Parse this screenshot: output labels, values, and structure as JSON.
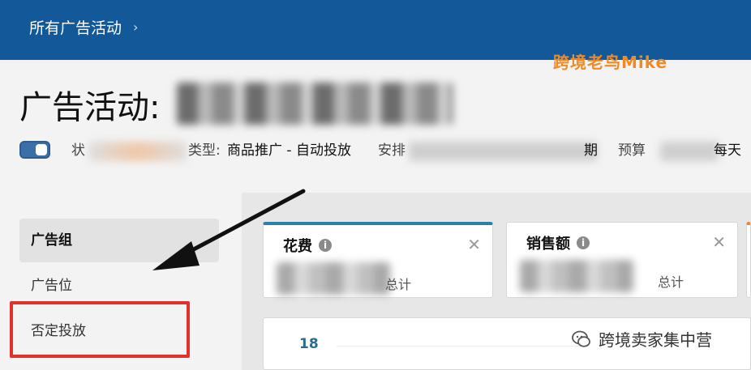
{
  "breadcrumb": {
    "text": "所有广告活动",
    "chevron": "›"
  },
  "watermark_top": "跨境老鸟Mike",
  "title": {
    "prefix": "广告活动:"
  },
  "status_row": {
    "status_label": "状",
    "type_label": "类型:",
    "type_value": "商品推广 - 自动投放",
    "schedule_label": "安排",
    "schedule_suffix": "期",
    "budget_label": "预算",
    "budget_suffix": "每天"
  },
  "nav": {
    "items": [
      {
        "label": "广告组",
        "active": true
      },
      {
        "label": "广告位",
        "active": false
      },
      {
        "label": "否定投放",
        "active": false
      }
    ]
  },
  "cards": [
    {
      "title": "花费",
      "foot_suffix": "总计",
      "accent": "#2d7fa8"
    },
    {
      "title": "销售额",
      "foot_suffix": "总计",
      "accent": ""
    }
  ],
  "card_close": "✕",
  "info_glyph": "i",
  "chart": {
    "ytick": "18"
  },
  "watermark_bottom": "跨境卖家集中营",
  "colors": {
    "topbar": "#13599a",
    "highlight_box": "#e2302b",
    "watermark": "#f08a24"
  }
}
